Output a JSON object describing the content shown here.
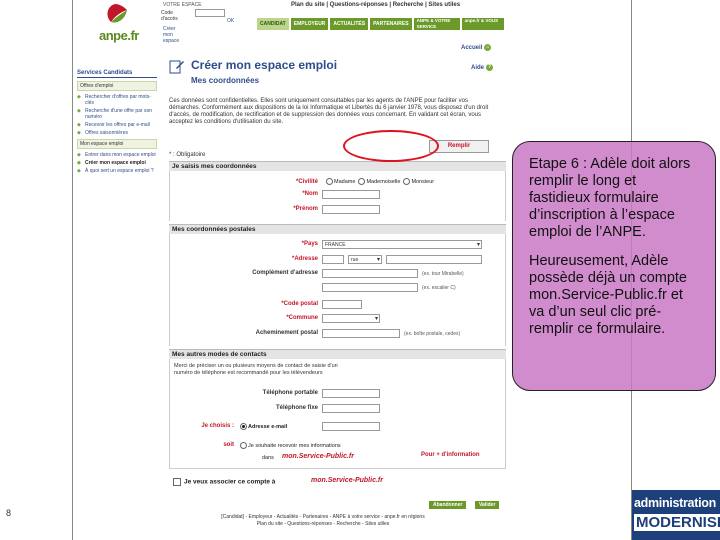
{
  "slide": {
    "page_number": "8"
  },
  "header": {
    "logo_text": "anpe.fr",
    "top_links": "Plan du site | Questions-réponses | Recherche | Sites utiles",
    "small_links": "VOTRE ESPACE",
    "code_label": "Code d'accès",
    "login_btn": "OK",
    "create_link": "Créer mon espace",
    "nav_tabs": [
      "CANDIDAT",
      "EMPLOYEUR",
      "ACTUALITÉS",
      "PARTENAIRES",
      "ANPE & VOTRE SERVICE",
      "anpe.fr & VOUS"
    ],
    "accueil": "Accueil",
    "aide": "Aide"
  },
  "sidebar": {
    "heading": "Services Candidats",
    "group1": "Offres d'emploi",
    "items1": [
      "Rechercher d'offres par mots-clés",
      "Recherche d'une offre par son numéro",
      "Recevoir les offres par e-mail",
      "Offres saisonnières"
    ],
    "group2": "Mon espace emploi",
    "items2": [
      "Entrer dans mon espace emploi",
      "Créer mon espace emploi",
      "À quoi sert un espace emploi ?"
    ]
  },
  "main": {
    "title": "Créer mon espace emploi",
    "subtitle": "Mes coordonnées",
    "intro": "Ces données sont confidentielles. Elles sont uniquement consultables par les agents de l'ANPE pour faciliter vos démarches. Conformément aux dispositions de la loi Informatique et Libertés du 6 janvier 1978, vous disposez d'un droit d'accès, de modification, de rectification et de suppression des données vous concernant. En validant cet écran, vous acceptez les conditions d'utilisation du site.",
    "prefill_button": "Remplir",
    "mandatory": "* : Obligatoire",
    "section1": "Je saisis mes coordonnées",
    "civilite_label": "*Civilité",
    "civilite_options": [
      "Madame",
      "Mademoiselle",
      "Monsieur"
    ],
    "nom_label": "*Nom",
    "prenom_label": "*Prénom",
    "section2": "Mes coordonnées postales",
    "pays_label": "*Pays",
    "pays_value": "FRANCE",
    "adresse_label": "*Adresse",
    "adresse_sel": "rue",
    "complement_label": "Complément d'adresse",
    "complement_hint1": "(ex. tour Mirabelle)",
    "complement_hint2": "(ex. escalier C)",
    "cp_label": "*Code postal",
    "commune_label": "*Commune",
    "achem_label": "Acheminement postal",
    "achem_hint": "(ex. boîte postale, cedex)",
    "section3": "Mes autres modes de contacts",
    "contact_text": "Merci de préciser un ou plusieurs moyens de contact de saisie d'un numéro de téléphone est recommandé pour les télévendeurs",
    "tel_portable": "Téléphone portable",
    "tel_fixe": "Téléphone fixe",
    "choisis_label": "Je choisis :",
    "email_option": "Adresse e-mail",
    "email_label": "Adresse e-mail",
    "soit_label": "soit",
    "soit_option": "Je souhaite recevoir mes informations",
    "dans_label": "dans",
    "msp_brand": "mon.Service-Public.fr",
    "plus_info": "Pour + d'information",
    "assoc_label": "Je veux associer ce compte à",
    "btn_abandon": "Abandonner",
    "btn_valider": "Valider",
    "footer1": "[Candidat] - Employeur - Actualités - Partenaires - ANPE à votre service - anpe.fr en régions",
    "footer2": "Plan du site - Questions-réponses - Recherche - Sites utiles"
  },
  "callout": {
    "para1": "Etape 6 : Adèle doit alors remplir le long et fastidieux formulaire d’inscription à l’espace emploi de l’ANPE.",
    "para2": "Heureusement, Adèle possède déjà un compte mon.Service-Public.fr et va d’un seul clic pré-remplir ce formulaire."
  },
  "brand": {
    "line1": "administration",
    "line2": "MODERNISE"
  },
  "colors": {
    "anpe_green": "#6b9a2a",
    "link_blue": "#2f4d8a",
    "highlight_red": "#e01020",
    "callout_purple": "#c978c4",
    "brand_navy": "#1d3f7a"
  }
}
